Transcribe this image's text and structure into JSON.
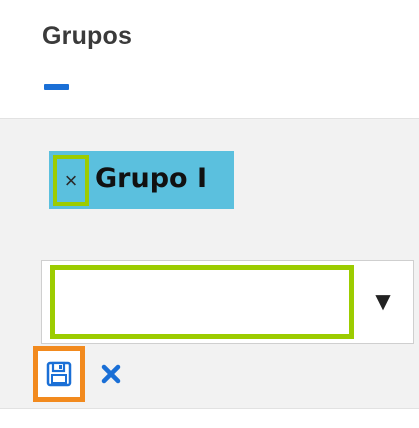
{
  "panel": {
    "title": "Grupos",
    "collapse_icon": "minus-icon"
  },
  "tags": [
    {
      "label": "Grupo I",
      "remove_symbol": "×",
      "remove_icon": "close-icon"
    }
  ],
  "select": {
    "value": "",
    "placeholder": "",
    "arrow_symbol": "▼",
    "arrow_icon": "caret-down-icon"
  },
  "actions": {
    "save_icon": "floppy-disk-icon",
    "cancel_icon": "close-icon"
  },
  "colors": {
    "accent_blue": "#1a6fd6",
    "tag_background": "#5bc0de",
    "highlight_green": "#9ccc00",
    "highlight_orange": "#f28a1e",
    "panel_background": "#f2f2f2"
  }
}
